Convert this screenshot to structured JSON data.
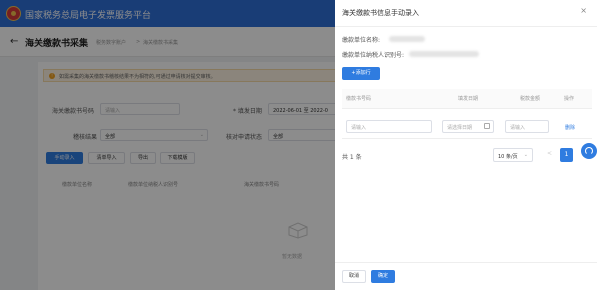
{
  "topbar": {
    "site_title": "国家税务总局电子发票服务平台"
  },
  "titlebar": {
    "page_title": "海关缴款书采集",
    "breadcrumb_1": "税务数字账户",
    "breadcrumb_2": "海关缴款书采集"
  },
  "notice": {
    "text": "如需采集的海关缴款书稽核结果不为相符的,可通过申请核对提交审核。"
  },
  "filters": {
    "no_label": "海关缴款书号码",
    "no_placeholder": "请输入",
    "date_label": "* 填发日期",
    "date_value": "2022-06-01 至 2022-0",
    "audit_label": "稽核结果",
    "audit_value": "全部",
    "check_label": "核对申请状态",
    "check_value": "全部"
  },
  "actions": {
    "manual": "手动录入",
    "import": "清单导入",
    "export": "导出",
    "download": "下载模版"
  },
  "bg_table": {
    "col1": "缴款单位名称",
    "col2": "缴款单位纳税人识别号",
    "col3": "海关缴款书号码"
  },
  "empty": {
    "text": "暂无数据"
  },
  "drawer": {
    "title": "海关缴款书信息手动录入",
    "close": "×",
    "payer_name_label": "缴款单位名称:",
    "payer_tax_label": "缴款单位纳税人识别号:",
    "add_row": "+添加行",
    "columns": [
      "缴款书号码",
      "填发日期",
      "税款金额",
      "操作"
    ],
    "row": {
      "no_placeholder": "请输入",
      "date_placeholder": "请选择日期",
      "amount_placeholder": "请输入",
      "delete": "删除"
    },
    "total": "共 1 条",
    "page_size": "10 条/页",
    "prev": "<",
    "page": "1",
    "cancel": "取消",
    "confirm": "确定"
  }
}
